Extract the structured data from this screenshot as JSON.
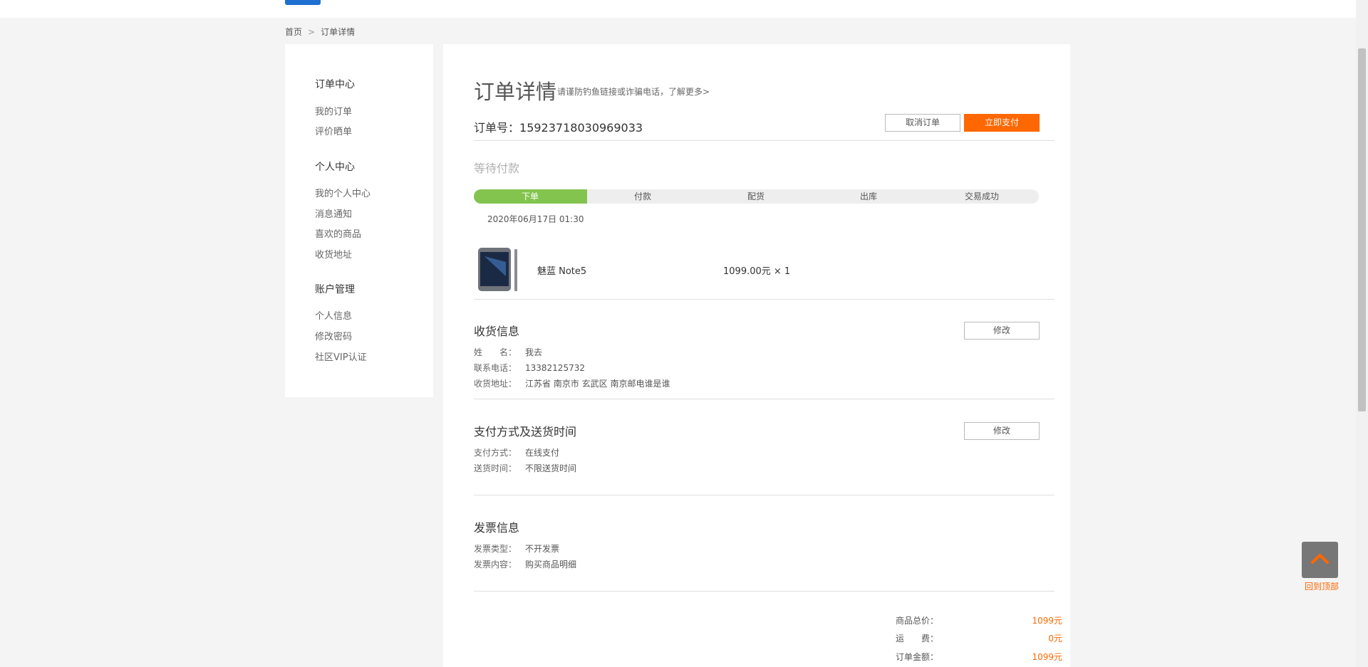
{
  "breadcrumb": {
    "home": "首页",
    "separator": ">",
    "current": "订单详情"
  },
  "sidebar": {
    "groups": [
      {
        "title": "订单中心",
        "items": [
          "我的订单",
          "评价晒单"
        ]
      },
      {
        "title": "个人中心",
        "items": [
          "我的个人中心",
          "消息通知",
          "喜欢的商品",
          "收货地址"
        ]
      },
      {
        "title": "账户管理",
        "items": [
          "个人信息",
          "修改密码",
          "社区VIP认证"
        ]
      }
    ]
  },
  "order": {
    "title": "订单详情",
    "tip": "请谨防钓鱼链接或诈骗电话，了解更多>",
    "number_label": "订单号：",
    "number": "15923718030969033",
    "cancel_label": "取消订单",
    "pay_label": "立即支付",
    "status": "等待付款",
    "progress": {
      "steps": [
        "下单",
        "付款",
        "配货",
        "出库",
        "交易成功"
      ],
      "completed_steps": 1
    },
    "time": "2020年06月17日 01:30",
    "product": {
      "image": "phone-thumbnail",
      "name": "魅蓝 Note5",
      "price": "1099.00元 × 1"
    }
  },
  "shipping": {
    "title": "收货信息",
    "edit_label": "修改",
    "rows": [
      {
        "key": "姓　　名：",
        "value": "我去"
      },
      {
        "key": "联系电话：",
        "value": "13382125732"
      },
      {
        "key": "收货地址：",
        "value": "江苏省 南京市 玄武区 南京邮电谁是谁"
      }
    ]
  },
  "payment": {
    "title": "支付方式及送货时间",
    "edit_label": "修改",
    "rows": [
      {
        "key": "支付方式：",
        "value": "在线支付"
      },
      {
        "key": "送货时间：",
        "value": "不限送货时间"
      }
    ]
  },
  "invoice": {
    "title": "发票信息",
    "rows": [
      {
        "key": "发票类型：",
        "value": "不开发票"
      },
      {
        "key": "发票内容：",
        "value": "购买商品明细"
      }
    ]
  },
  "summary": {
    "rows": [
      {
        "label": "商品总价：",
        "value": "1099元"
      },
      {
        "label": "运　　费：",
        "value": "0元"
      },
      {
        "label": "订单金额：",
        "value": "1099元"
      }
    ]
  },
  "back_to_top": {
    "label": "回到顶部",
    "icon": "chevron-up-icon"
  },
  "colors": {
    "accent": "#ff6700",
    "progress": "#83c44e",
    "top_button": "#1e6fd0"
  }
}
